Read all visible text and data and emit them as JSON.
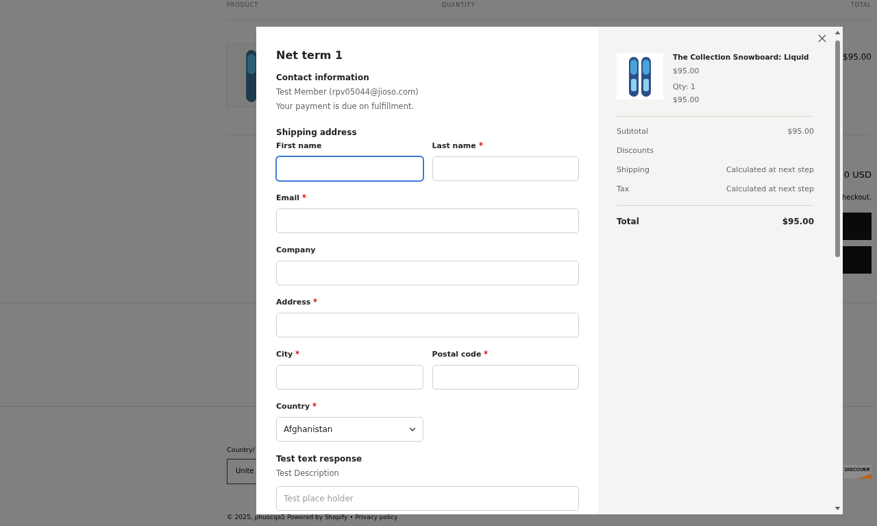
{
  "background_page": {
    "columns": [
      "PRODUCT",
      "QUANTITY",
      "TOTAL"
    ],
    "item": {
      "price": "$95.00"
    },
    "summary": {
      "total_fragment": "0 USD",
      "note_fragment": "heckout."
    },
    "footer": {
      "country_label": "Country/",
      "country_value": "Unite",
      "payment_icons": [
        "DISCOVER"
      ],
      "copyright": "© 2025, phuocqa5 Powered by Shopify • Privacy policy"
    }
  },
  "modal": {
    "title": "Net term 1",
    "contact": {
      "heading": "Contact information",
      "lines": [
        "Test Member (rpv05044@jioso.com)",
        "Your payment is due on fulfillment."
      ]
    },
    "shipping": {
      "heading": "Shipping address",
      "rows": [
        [
          {
            "kind": "text",
            "label": "First name",
            "required": false,
            "focused": true
          },
          {
            "kind": "text",
            "label": "Last name",
            "required": true,
            "focused": false
          }
        ],
        [
          {
            "kind": "text",
            "label": "Email",
            "required": true,
            "focused": false
          }
        ],
        [
          {
            "kind": "text",
            "label": "Company",
            "required": false,
            "focused": false
          }
        ],
        [
          {
            "kind": "text",
            "label": "Address",
            "required": true,
            "focused": false
          }
        ],
        [
          {
            "kind": "text",
            "label": "City",
            "required": true,
            "focused": false
          },
          {
            "kind": "text",
            "label": "Postal code",
            "required": true,
            "focused": false
          }
        ],
        [
          {
            "kind": "select",
            "label": "Country",
            "required": true,
            "focused": false,
            "value": "Afghanistan"
          }
        ]
      ]
    },
    "custom_field": {
      "label": "Test text response",
      "description": "Test Description",
      "placeholder": "Test place holder"
    },
    "order": {
      "product": {
        "name": "The Collection Snowboard: Liquid",
        "price": "$95.00",
        "quantity": "Qty: 1",
        "line_total": "$95.00"
      },
      "rows": [
        {
          "label": "Subtotal",
          "value": "$95.00"
        },
        {
          "label": "Discounts"
        },
        {
          "label": "Shipping",
          "value": "Calculated at next step"
        },
        {
          "label": "Tax",
          "value": "Calculated at next step"
        }
      ],
      "total": {
        "label": "Total",
        "value": "$95.00"
      }
    }
  }
}
